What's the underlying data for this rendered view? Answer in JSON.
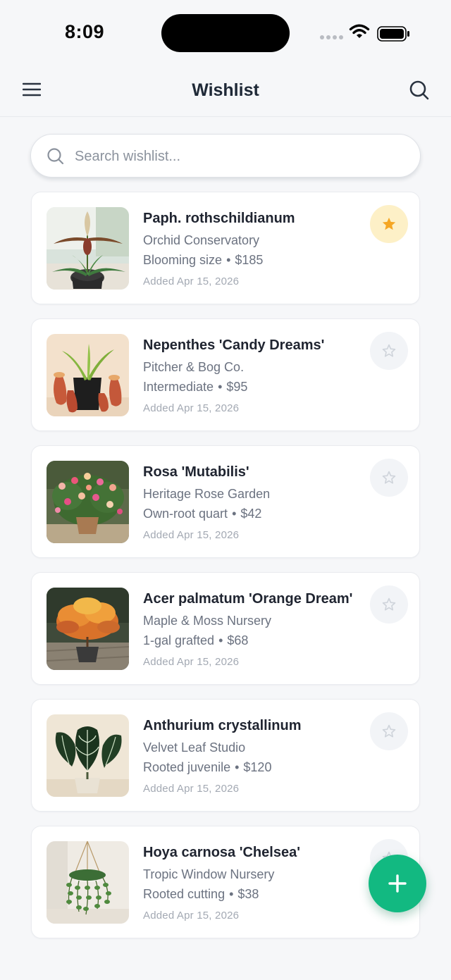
{
  "status_bar": {
    "time": "8:09"
  },
  "header": {
    "title": "Wishlist",
    "menu_icon": "hamburger-menu-icon",
    "search_icon": "search-icon"
  },
  "search": {
    "placeholder": "Search wishlist...",
    "value": ""
  },
  "colors": {
    "accent": "#12b981",
    "favorite_active_bg": "#fdf0c7",
    "favorite_star": "#f5a623",
    "favorite_inactive": "#cfd4db"
  },
  "items": [
    {
      "name": "Paph. rothschildianum",
      "seller": "Orchid Conservatory",
      "size": "Blooming size",
      "price": "$185",
      "added": "Added Apr 15, 2026",
      "favorite": true,
      "image": "slipper-orchid"
    },
    {
      "name": "Nepenthes 'Candy Dreams'",
      "seller": "Pitcher & Bog Co.",
      "size": "Intermediate",
      "price": "$95",
      "added": "Added Apr 15, 2026",
      "favorite": false,
      "image": "pitcher-plant"
    },
    {
      "name": "Rosa 'Mutabilis'",
      "seller": "Heritage Rose Garden",
      "size": "Own-root quart",
      "price": "$42",
      "added": "Added Apr 15, 2026",
      "favorite": false,
      "image": "rose-bush"
    },
    {
      "name": "Acer palmatum 'Orange Dream'",
      "seller": "Maple & Moss Nursery",
      "size": "1-gal grafted",
      "price": "$68",
      "added": "Added Apr 15, 2026",
      "favorite": false,
      "image": "japanese-maple"
    },
    {
      "name": "Anthurium crystallinum",
      "seller": "Velvet Leaf Studio",
      "size": "Rooted juvenile",
      "price": "$120",
      "added": "Added Apr 15, 2026",
      "favorite": false,
      "image": "anthurium"
    },
    {
      "name": "Hoya carnosa 'Chelsea'",
      "seller": "Tropic Window Nursery",
      "size": "Rooted cutting",
      "price": "$38",
      "added": "Added Apr 15, 2026",
      "favorite": false,
      "image": "hanging-hoya"
    }
  ],
  "fab": {
    "icon": "plus-icon"
  },
  "meta_separator": "•"
}
